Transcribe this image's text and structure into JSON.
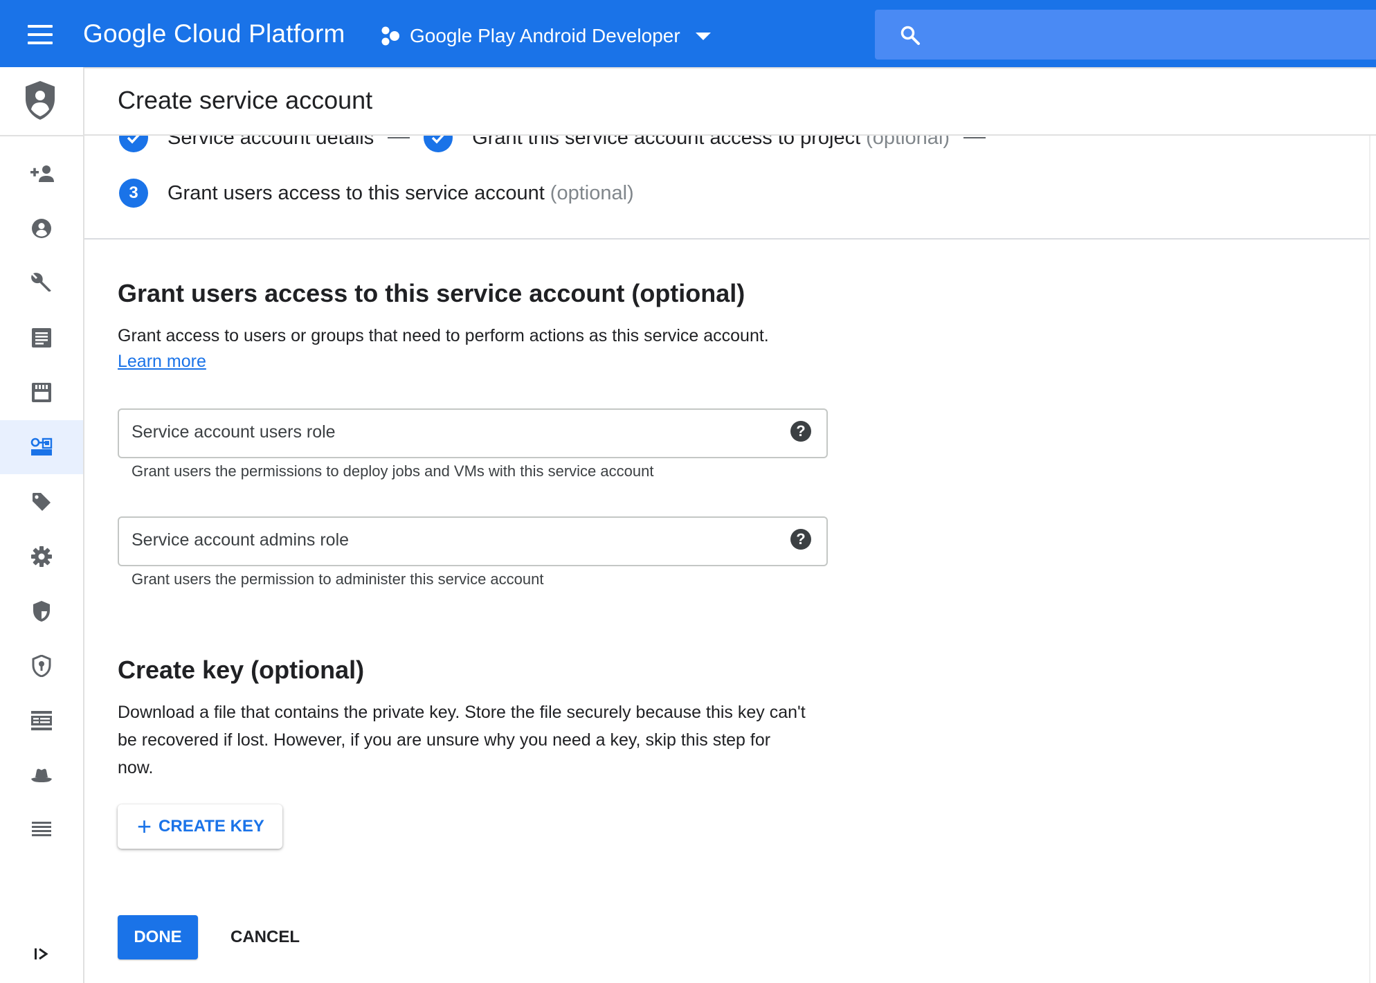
{
  "topbar": {
    "brand": "Google Cloud Platform",
    "project": "Google Play Android Developer",
    "search_placeholder": ""
  },
  "page": {
    "title": "Create service account"
  },
  "stepper": {
    "step1_label": "Service account details",
    "step2_label": "Grant this service account access to project",
    "step2_optional": "(optional)",
    "step3_number": "3",
    "step3_label": "Grant users access to this service account",
    "step3_optional": "(optional)"
  },
  "grant_section": {
    "heading": "Grant users access to this service account (optional)",
    "description": "Grant access to users or groups that need to perform actions as this service account.",
    "learn_more": "Learn more",
    "users_role_label": "Service account users role",
    "users_role_hint": "Grant users the permissions to deploy jobs and VMs with this service account",
    "admins_role_label": "Service account admins role",
    "admins_role_hint": "Grant users the permission to administer this service account",
    "help_glyph": "?"
  },
  "key_section": {
    "heading": "Create key (optional)",
    "description": "Download a file that contains the private key. Store the file securely because this key can't be recovered if lost. However, if you are unsure why you need a key, skip this step for now.",
    "create_key_label": "CREATE KEY"
  },
  "actions": {
    "done": "DONE",
    "cancel": "CANCEL"
  },
  "sidebar": {
    "active_item": "service-accounts",
    "items": [
      "add-member-icon",
      "account-icon",
      "wrench-icon",
      "document-icon",
      "storage-icon",
      "service-accounts-icon",
      "label-icon",
      "settings-icon",
      "shield-icon",
      "security-key-icon",
      "list-view-icon",
      "hat-icon",
      "stacked-list-icon"
    ]
  },
  "colors": {
    "primary": "#1a73e8",
    "search_bg": "#4a8af4",
    "active_bg": "#e8f0fe"
  }
}
